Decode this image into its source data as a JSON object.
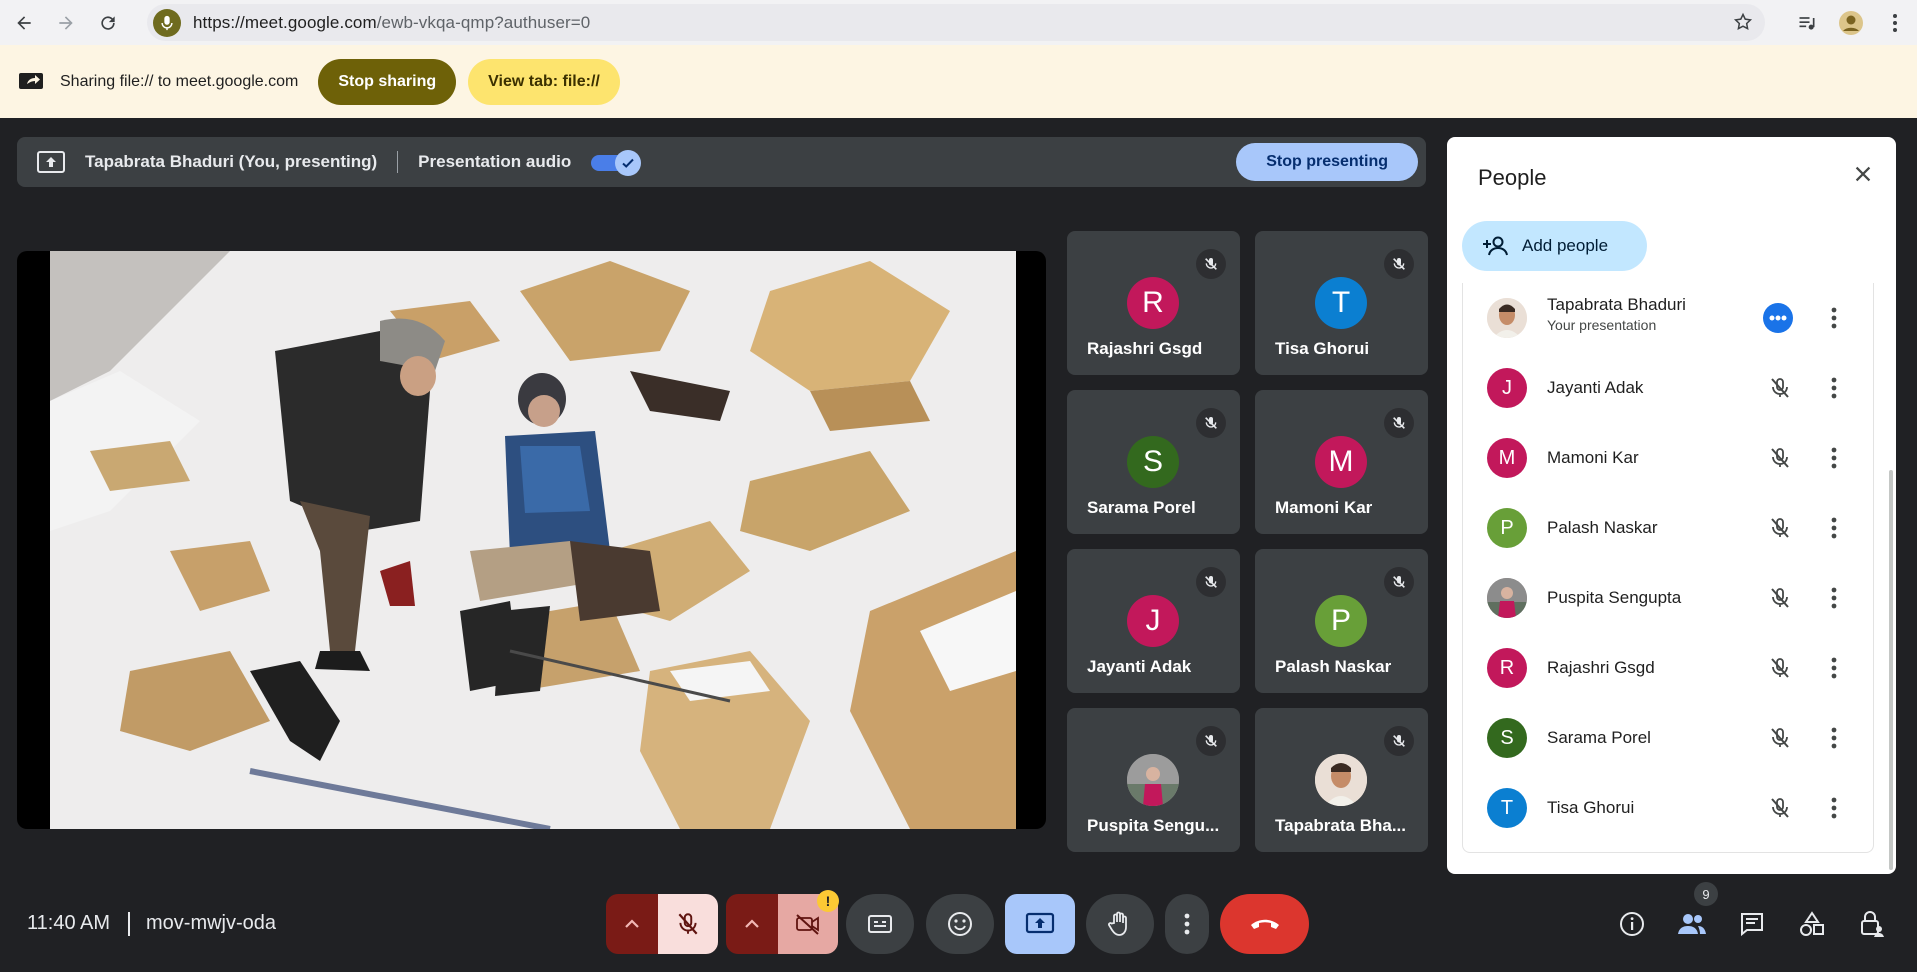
{
  "browser": {
    "url_main": "https://meet.google.com",
    "url_rest": "/ewb-vkqa-qmp?authuser=0"
  },
  "sharebar": {
    "text": "Sharing file:// to meet.google.com",
    "stop_label": "Stop sharing",
    "view_label": "View tab: file://"
  },
  "presentbar": {
    "name": "Tapabrata Bhaduri (You, presenting)",
    "audio_label": "Presentation audio",
    "audio_on": true,
    "stop_label": "Stop presenting"
  },
  "tiles": [
    {
      "name": "Rajashri Gsgd",
      "initial": "R",
      "color": "#c2185b"
    },
    {
      "name": "Tisa Ghorui",
      "initial": "T",
      "color": "#0b7fd1"
    },
    {
      "name": "Sarama Porel",
      "initial": "S",
      "color": "#33691e"
    },
    {
      "name": "Mamoni Kar",
      "initial": "M",
      "color": "#c2185b"
    },
    {
      "name": "Jayanti Adak",
      "initial": "J",
      "color": "#c2185b"
    },
    {
      "name": "Palash Naskar",
      "initial": "P",
      "color": "#689f38"
    },
    {
      "name": "Puspita Sengu...",
      "initial": "",
      "color": "#6d6d6d"
    },
    {
      "name": "Tapabrata Bha...",
      "initial": "",
      "color": "#e8d9cf"
    }
  ],
  "people": {
    "title": "People",
    "add_label": "Add people",
    "list": [
      {
        "name": "Tapabrata Bhaduri",
        "sub": "Your presentation",
        "initial": "",
        "color": "#c9a58a"
      },
      {
        "name": "Jayanti Adak",
        "initial": "J",
        "color": "#c2185b"
      },
      {
        "name": "Mamoni Kar",
        "initial": "M",
        "color": "#c2185b"
      },
      {
        "name": "Palash Naskar",
        "initial": "P",
        "color": "#689f38"
      },
      {
        "name": "Puspita Sengupta",
        "initial": "",
        "color": "#7a6a6a"
      },
      {
        "name": "Rajashri Gsgd",
        "initial": "R",
        "color": "#c2185b"
      },
      {
        "name": "Sarama Porel",
        "initial": "S",
        "color": "#33691e"
      },
      {
        "name": "Tisa Ghorui",
        "initial": "T",
        "color": "#0b7fd1"
      }
    ]
  },
  "bottom": {
    "time": "11:40 AM",
    "meeting_code": "mov-mwjv-oda",
    "people_count": "9",
    "warning_mark": "!"
  }
}
